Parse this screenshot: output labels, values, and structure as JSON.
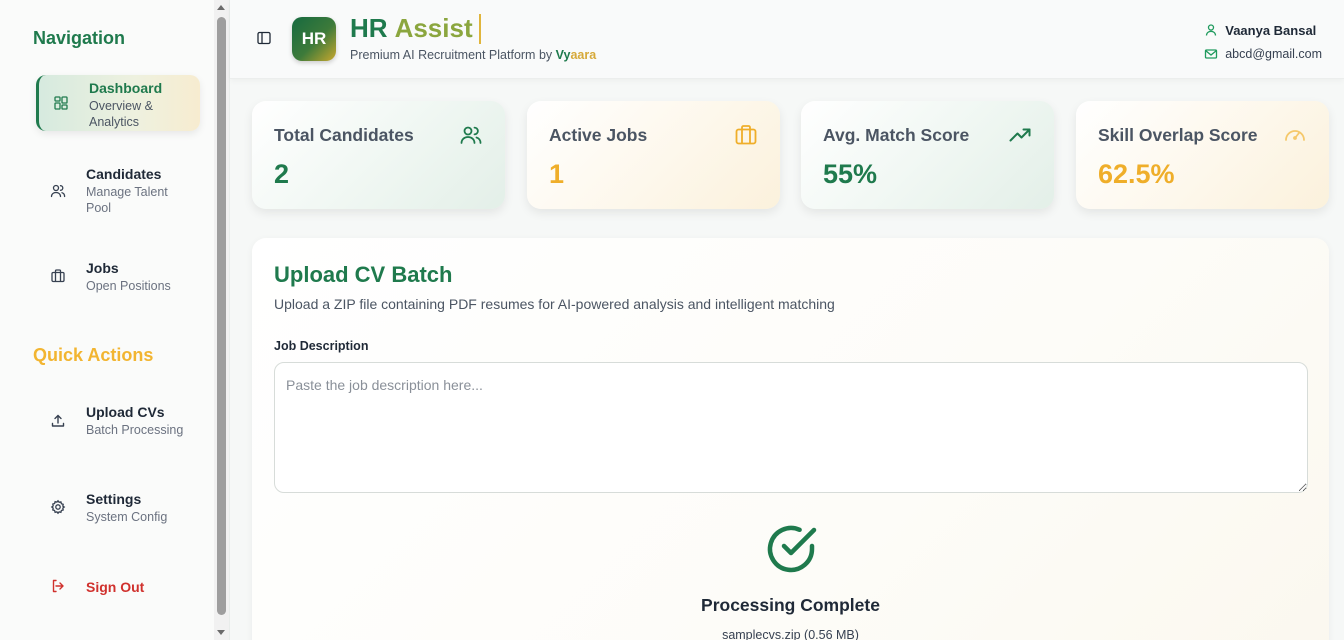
{
  "sidebar": {
    "navigation_title": "Navigation",
    "quick_actions_title": "Quick Actions",
    "nav_items": [
      {
        "label": "Dashboard",
        "sub": "Overview & Analytics",
        "icon": "grid-icon"
      },
      {
        "label": "Candidates",
        "sub": "Manage Talent Pool",
        "icon": "users-icon"
      },
      {
        "label": "Jobs",
        "sub": "Open Positions",
        "icon": "briefcase-icon"
      }
    ],
    "quick_actions": [
      {
        "label": "Upload CVs",
        "sub": "Batch Processing",
        "icon": "upload-icon"
      },
      {
        "label": "Settings",
        "sub": "System Config",
        "icon": "gear-icon"
      }
    ],
    "sign_out": {
      "label": "Sign Out",
      "icon": "logout-icon"
    }
  },
  "header": {
    "logo_text": "HR",
    "brand_hr": "HR",
    "brand_assist": "Assist",
    "tagline_prefix": "Premium AI Recruitment Platform by",
    "tagline_vy": "Vy",
    "tagline_aara": "aara",
    "user_name": "Vaanya Bansal",
    "user_email": "abcd@gmail.com"
  },
  "stats": [
    {
      "title": "Total Candidates",
      "value": "2",
      "icon": "users-icon"
    },
    {
      "title": "Active Jobs",
      "value": "1",
      "icon": "briefcase-icon"
    },
    {
      "title": "Avg. Match Score",
      "value": "55%",
      "icon": "trending-up-icon"
    },
    {
      "title": "Skill Overlap Score",
      "value": "62.5%",
      "icon": "gauge-icon"
    }
  ],
  "upload": {
    "title": "Upload CV Batch",
    "description": "Upload a ZIP file containing PDF resumes for AI-powered analysis and intelligent matching",
    "job_description_label": "Job Description",
    "job_description_placeholder": "Paste the job description here...",
    "job_description_value": "",
    "status_title": "Processing Complete",
    "file_info": "samplecvs.zip (0.56 MB)"
  },
  "colors": {
    "brand_green": "#1f7a4d",
    "brand_gold": "#efae2a",
    "danger": "#d0312d"
  }
}
